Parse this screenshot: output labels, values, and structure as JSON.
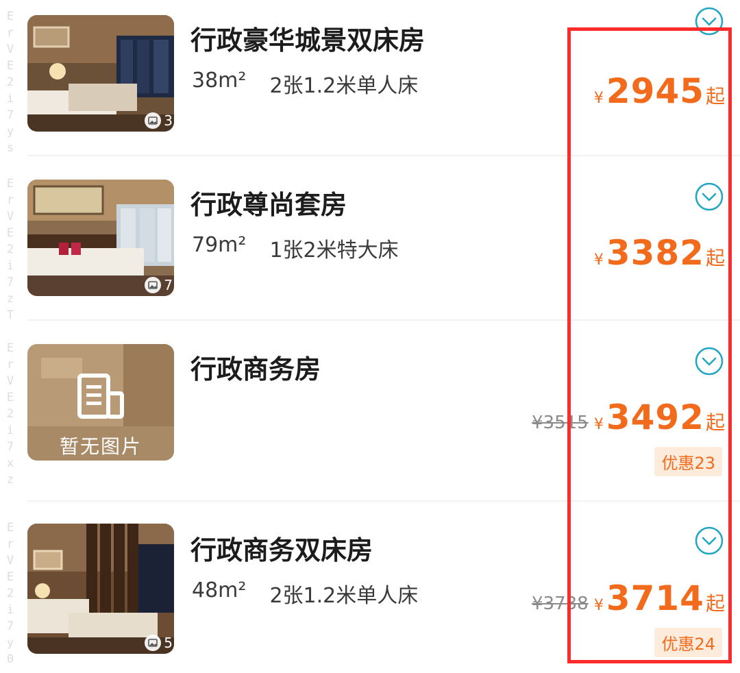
{
  "watermark": {
    "segments": [
      "ErVE2i7ys",
      "ErVE2i7zT",
      "ErVE2i7xz",
      "ErVE2i7y0"
    ]
  },
  "rooms": [
    {
      "title": "行政豪华城景双床房",
      "area": "38m²",
      "bed": "2张1.2米单人床",
      "photo_count": "3",
      "currency": "¥",
      "price": "2945",
      "price_suffix": "起",
      "old_price": "",
      "discount": ""
    },
    {
      "title": "行政尊尚套房",
      "area": "79m²",
      "bed": "1张2米特大床",
      "photo_count": "7",
      "currency": "¥",
      "price": "3382",
      "price_suffix": "起",
      "old_price": "",
      "discount": ""
    },
    {
      "title": "行政商务房",
      "area": "",
      "bed": "",
      "photo_count": "",
      "no_image_label": "暂无图片",
      "currency": "¥",
      "price": "3492",
      "price_suffix": "起",
      "old_price": "¥3515",
      "discount": "优惠23"
    },
    {
      "title": "行政商务双床房",
      "area": "48m²",
      "bed": "2张1.2米单人床",
      "photo_count": "5",
      "currency": "¥",
      "price": "3714",
      "price_suffix": "起",
      "old_price": "¥3738",
      "discount": "优惠24"
    }
  ],
  "colors": {
    "price": "#f26b1d",
    "chevron": "#1fa6c2",
    "highlight_box": "#ff2a2a"
  },
  "icons": {
    "expand": "chevron-down-circle-icon",
    "photos": "photo-icon",
    "no_image": "document-icon"
  }
}
